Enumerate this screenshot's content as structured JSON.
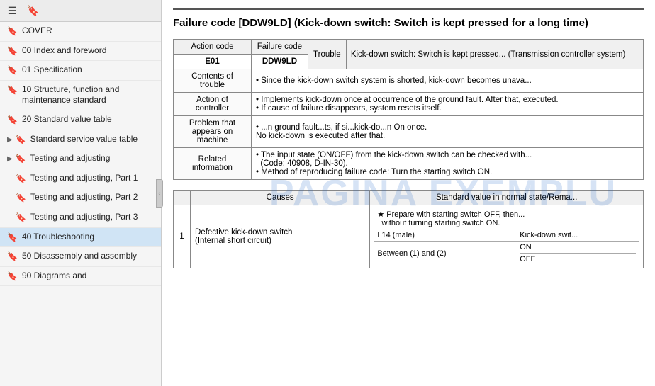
{
  "sidebar": {
    "toolbar": {
      "icon1": "☰",
      "icon2": "🔖"
    },
    "items": [
      {
        "id": "cover",
        "label": "COVER",
        "indent": 0,
        "expand": null
      },
      {
        "id": "00-index",
        "label": "00 Index and foreword",
        "indent": 0,
        "expand": null
      },
      {
        "id": "01-spec",
        "label": "01 Specification",
        "indent": 0,
        "expand": null
      },
      {
        "id": "10-structure",
        "label": "10 Structure, function and maintenance standard",
        "indent": 0,
        "expand": null
      },
      {
        "id": "20-standard",
        "label": "20 Standard value table",
        "indent": 0,
        "expand": null
      },
      {
        "id": "standard-service",
        "label": "Standard service value table",
        "indent": 0,
        "expand": "▶"
      },
      {
        "id": "testing-adjusting",
        "label": "Testing and adjusting",
        "indent": 0,
        "expand": "▶"
      },
      {
        "id": "testing-part1",
        "label": "Testing and adjusting, Part 1",
        "indent": 1,
        "expand": null
      },
      {
        "id": "testing-part2",
        "label": "Testing and adjusting, Part 2",
        "indent": 1,
        "expand": null
      },
      {
        "id": "testing-part3",
        "label": "Testing and adjusting, Part 3",
        "indent": 1,
        "expand": null
      },
      {
        "id": "40-trouble",
        "label": "40 Troubleshooting",
        "indent": 0,
        "expand": null,
        "active": true
      },
      {
        "id": "50-disassembly",
        "label": "50 Disassembly and assembly",
        "indent": 0,
        "expand": null
      },
      {
        "id": "90-diagrams",
        "label": "90 Diagrams and",
        "indent": 0,
        "expand": null
      }
    ]
  },
  "main": {
    "title": "Failure code [DDW9LD] (Kick-down switch: Switch is kept pressed for a long time)",
    "info_table": {
      "headers": [
        "Action code",
        "Failure code",
        "Trouble"
      ],
      "action_code": "E01",
      "failure_code": "DDW9LD",
      "trouble": "Trouble",
      "trouble_desc": "Kick-down switch: Switch is kept pressed... (Transmission controller system)",
      "rows": [
        {
          "label": "Contents of trouble",
          "content": "Since the kick-down switch system is shorted, kick-down becomes unava..."
        },
        {
          "label": "Action of controller",
          "content": "• Implements kick-down once at occurrence of the ground fault. After that,\n  executed.\n• If cause of failure disappears, system resets itself."
        },
        {
          "label": "Problem that appears on machine",
          "content": "• ...n ground fault...ts, if si...kick-do...n On once.\n  No kick-down is executed after that."
        },
        {
          "label": "Related information",
          "content": "• The input state (ON/OFF) from the kick-down switch can be checked with...\n  (Code: 40908, D-IN-30).\n• Method of reproducing failure code: Turn the starting switch ON."
        }
      ]
    },
    "causes_table": {
      "headers": [
        "",
        "Causes",
        "Standard value in normal state/Rema..."
      ],
      "rows": [
        {
          "num": "1",
          "cause": "Defective kick-down switch (Internal short circuit)",
          "sub_rows": [
            {
              "condition": "★ Prepare with starting switch OFF, then...\n  without turning starting switch ON.",
              "col2": ""
            },
            {
              "col1": "L14 (male)",
              "col2": "Kick-down swit..."
            },
            {
              "col1": "Between (1) and (2)",
              "col2_rows": [
                "ON",
                "OFF"
              ]
            }
          ]
        }
      ]
    }
  },
  "watermark": "PAGINA EXEMPLU"
}
